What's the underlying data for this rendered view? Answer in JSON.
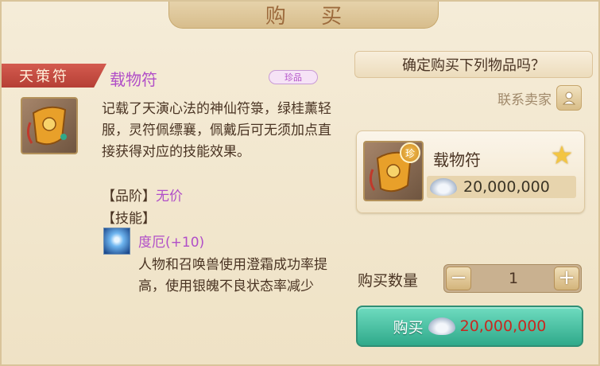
{
  "dialog": {
    "title": "购 买"
  },
  "left": {
    "category_tag": "天策符",
    "item_name": "载物符",
    "rarity_badge": "珍品",
    "description": "记载了天演心法的神仙符箓，绿桂薰轻服，灵符佩缥襄，佩戴后可无须加点直接获得对应的技能效果。",
    "grade_label": "【品阶】",
    "grade_value": "无价",
    "skill_label": "【技能】",
    "skill_name": "度厄(+10)",
    "skill_description": "人物和召唤兽使用澄霜成功率提高，使用银魄不良状态率减少"
  },
  "right": {
    "confirm_text": "确定购买下列物品吗？",
    "contact_seller": "联系卖家",
    "card": {
      "rare_mark": "珍",
      "item_name": "载物符",
      "price": "20,000,000"
    },
    "quantity_label": "购买数量",
    "quantity_value": "1",
    "minus_symbol": "−",
    "plus_symbol": "+",
    "buy_label": "购买",
    "buy_price": "20,000,000"
  },
  "colors": {
    "rare_purple": "#b14fc8",
    "tag_red": "#c84a3f",
    "buy_green": "#3cb597",
    "price_red": "#c8281f"
  },
  "icons": [
    "item-icon",
    "skill-icon",
    "contact-icon",
    "star-icon",
    "silver-ingot-icon"
  ]
}
